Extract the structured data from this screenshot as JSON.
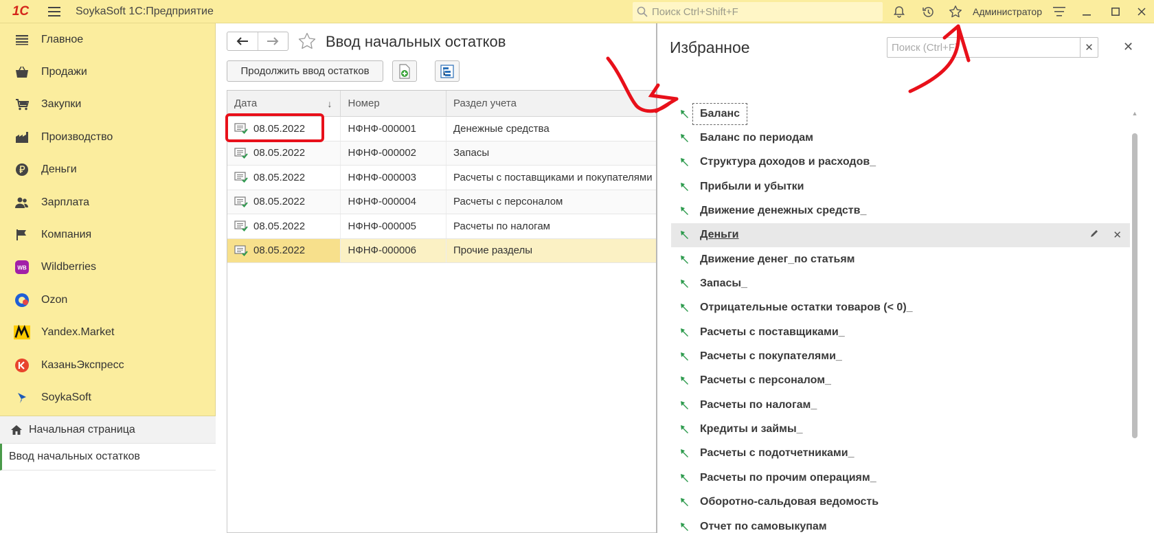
{
  "app": {
    "logo": "1С",
    "title": "SoykaSoft 1С:Предприятие"
  },
  "topbar": {
    "search_placeholder": "Поиск Ctrl+Shift+F",
    "user": "Администратор"
  },
  "sidebar": {
    "items": [
      {
        "label": "Главное",
        "icon": "list-icon"
      },
      {
        "label": "Продажи",
        "icon": "basket-icon"
      },
      {
        "label": "Закупки",
        "icon": "cart-icon"
      },
      {
        "label": "Производство",
        "icon": "factory-icon"
      },
      {
        "label": "Деньги",
        "icon": "ruble-icon"
      },
      {
        "label": "Зарплата",
        "icon": "people-icon"
      },
      {
        "label": "Компания",
        "icon": "flag-icon"
      },
      {
        "label": "Wildberries",
        "icon": "wildberries-logo"
      },
      {
        "label": "Ozon",
        "icon": "ozon-logo"
      },
      {
        "label": "Yandex.Market",
        "icon": "yandex-market-logo"
      },
      {
        "label": "КазаньЭкспресс",
        "icon": "kazanexpress-logo"
      },
      {
        "label": "SoykaSoft",
        "icon": "soykasoft-logo"
      }
    ],
    "home": "Начальная страница",
    "open_tab": "Ввод начальных остатков"
  },
  "main": {
    "title": "Ввод начальных остатков",
    "continue_button": "Продолжить ввод остатков",
    "table": {
      "headers": [
        "Дата",
        "Номер",
        "Раздел учета"
      ],
      "rows": [
        {
          "date": "08.05.2022",
          "number": "НФНФ-000001",
          "section": "Денежные средства"
        },
        {
          "date": "08.05.2022",
          "number": "НФНФ-000002",
          "section": "Запасы"
        },
        {
          "date": "08.05.2022",
          "number": "НФНФ-000003",
          "section": "Расчеты с поставщиками и покупателями"
        },
        {
          "date": "08.05.2022",
          "number": "НФНФ-000004",
          "section": "Расчеты с персоналом"
        },
        {
          "date": "08.05.2022",
          "number": "НФНФ-000005",
          "section": "Расчеты по налогам"
        },
        {
          "date": "08.05.2022",
          "number": "НФНФ-000006",
          "section": "Прочие разделы"
        }
      ]
    }
  },
  "favorites": {
    "title": "Избранное",
    "search_placeholder": "Поиск (Ctrl+F)",
    "items": [
      "Баланс",
      "Баланс по периодам",
      "Структура доходов и расходов_",
      "Прибыли и убытки",
      "Движение денежных средств_",
      "Деньги",
      "Движение денег_по статьям",
      "Запасы_",
      "Отрицательные остатки товаров (< 0)_",
      "Расчеты с поставщиками_",
      "Расчеты с покупателями_",
      "Расчеты с персоналом_",
      "Расчеты по налогам_",
      "Кредиты и займы_",
      "Расчеты с подотчетниками_",
      "Расчеты по прочим операциям_",
      "Оборотно-сальдовая ведомость",
      "Отчет по самовыкупам"
    ]
  },
  "colors": {
    "accent_yellow": "#fbed9e",
    "annotation_red": "#e8101a",
    "pin_green": "#2e9b4e"
  }
}
